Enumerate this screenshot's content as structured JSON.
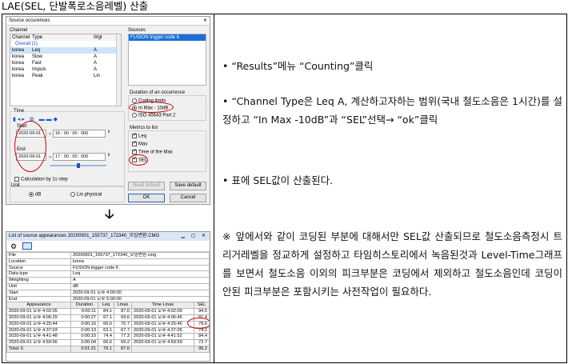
{
  "title": "LAE(SEL, 단발폭로소음레벨) 산출",
  "right": {
    "p1": "• “Results”메뉴 “Counting”클릭",
    "p2": "• “Channel Type은 Leq A, 계산하고자하는 범위(국내 철도소음은 1시간)를 설정하고 “In Max -10dB”과 “SEL”선택→ “ok”클릭",
    "p3": "• 표에 SEL값이 산출된다.",
    "p4": "※ 앞에서와 같이 코딩된 부분에 대해서만 SEL값 산출되므로 철도소음측정시 트리거레벨을 정교하게 설정하고 타임히스토리에서 녹음된것과 Level-Time그래프를 보면서 철도소음 이외의 피크부분은 코딩에서 제외하고 철도소음인데 코딩이 안된 피크부분은 포함시키는 사전작업이 필요하다."
  },
  "arrow": "🡣",
  "dialog": {
    "title": "Source occurences",
    "close": "✕",
    "channel_label": "Channel",
    "col_channel": "Channel",
    "col_type": "Type",
    "col_wgt": "Wgt",
    "overall": "Overall (1)",
    "rows": [
      {
        "channel": "korea",
        "type": "Leq",
        "wgt": "A"
      },
      {
        "channel": "korea",
        "type": "Slow",
        "wgt": "A"
      },
      {
        "channel": "korea",
        "type": "Fast",
        "wgt": "A"
      },
      {
        "channel": "korea",
        "type": "Impuls",
        "wgt": "A"
      },
      {
        "channel": "korea",
        "type": "Peak",
        "wgt": "Lin"
      }
    ],
    "sources_label": "Sources",
    "sources_item": "FUSION trigger code 6",
    "time_label": "Time",
    "start_label": "Start",
    "start_date": "2020-09-01",
    "start_time": "16 : 00 : 00 : 000",
    "end_label": "End",
    "end_date": "2020-09-01",
    "end_time": "17 : 00 : 00 : 000",
    "calc_1s": "Calculation by 1s step",
    "duration_label": "Duration of an occurrence",
    "dur_opt1": "Coding limits",
    "dur_opt2": "In Max - 10dB",
    "dur_opt3": "ISO 45643 Part 2",
    "metrics_label": "Metrics to list",
    "metric_leq": "Leq",
    "metric_max": "Max",
    "metric_time_max": "Time of the Max",
    "metric_sel": "SEL",
    "unit_label": "Unit",
    "unit_db": "dB",
    "unit_lin": "Lin physical",
    "btn_read_default": "Read default",
    "btn_save_default": "Save default",
    "btn_ok": "OK",
    "btn_cancel": "Cancel"
  },
  "results": {
    "title": "List of source appearances  20200901_155737_172340_모임변환.CMG",
    "buttons": "▁ ▢ ✕",
    "file_label": "File",
    "file_value": "20200901_155737_172340_모임변환.cmg",
    "location_label": "Location",
    "location_value": "korea",
    "source_label": "Source",
    "source_value": "FUSION trigger code 6",
    "datatype_label": "Data type",
    "datatype_value": "Leq",
    "weighting_label": "Weighting",
    "weighting_value": "A",
    "unit_label": "Unit",
    "unit_value": "dB",
    "start_label": "Start",
    "start_value": "2020-09-01 오후 4:00:00",
    "end_label": "End",
    "end_value": "2020-09-01 오후 5:00:00",
    "col_appearance": "Appearance",
    "col_duration": "Duration",
    "col_leq": "Leq",
    "col_lmax": "Lmax",
    "col_time_lmax": "Time Lmax",
    "col_sel": "SEL",
    "rows": [
      {
        "app": "2020-09-01 오후 4:02:05",
        "dur": "0:00:11",
        "leq": "84.1",
        "lmax": "87.6",
        "tl": "2020-09-01 오후 4:02:09",
        "sel": "94.5"
      },
      {
        "app": "2020-09-01 오후 4:06:29",
        "dur": "0:00:27",
        "leq": "67.1",
        "lmax": "69.6",
        "tl": "2020-09-01 오후 4:06:46",
        "sel": "81.4"
      },
      {
        "app": "2020-09-01 오후 4:25:44",
        "dur": "0:00:16",
        "leq": "66.6",
        "lmax": "70.7",
        "tl": "2020-09-01 오후 4:25:46",
        "sel": "78.6"
      },
      {
        "app": "2020-09-01 오후 4:37:03",
        "dur": "0:00:13",
        "leq": "63.1",
        "lmax": "67.7",
        "tl": "2020-09-01 오후 4:37:05",
        "sel": "74.2"
      },
      {
        "app": "2020-09-01 오후 4:41:48",
        "dur": "0:00:10",
        "leq": "74.4",
        "lmax": "77.3",
        "tl": "2020-09-01 오후 4:41:52",
        "sel": "84.4"
      },
      {
        "app": "2020-09-01 오후 4:59:56",
        "dur": "0:00:04",
        "leq": "66.6",
        "lmax": "69.2",
        "tl": "2020-09-01 오후 4:59:59",
        "sel": "72.7"
      }
    ],
    "total_label": "Total: 6",
    "total_dur": "0:01:21",
    "total_leq": "76.1",
    "total_lmax": "87.6",
    "total_sel": "95.2"
  }
}
